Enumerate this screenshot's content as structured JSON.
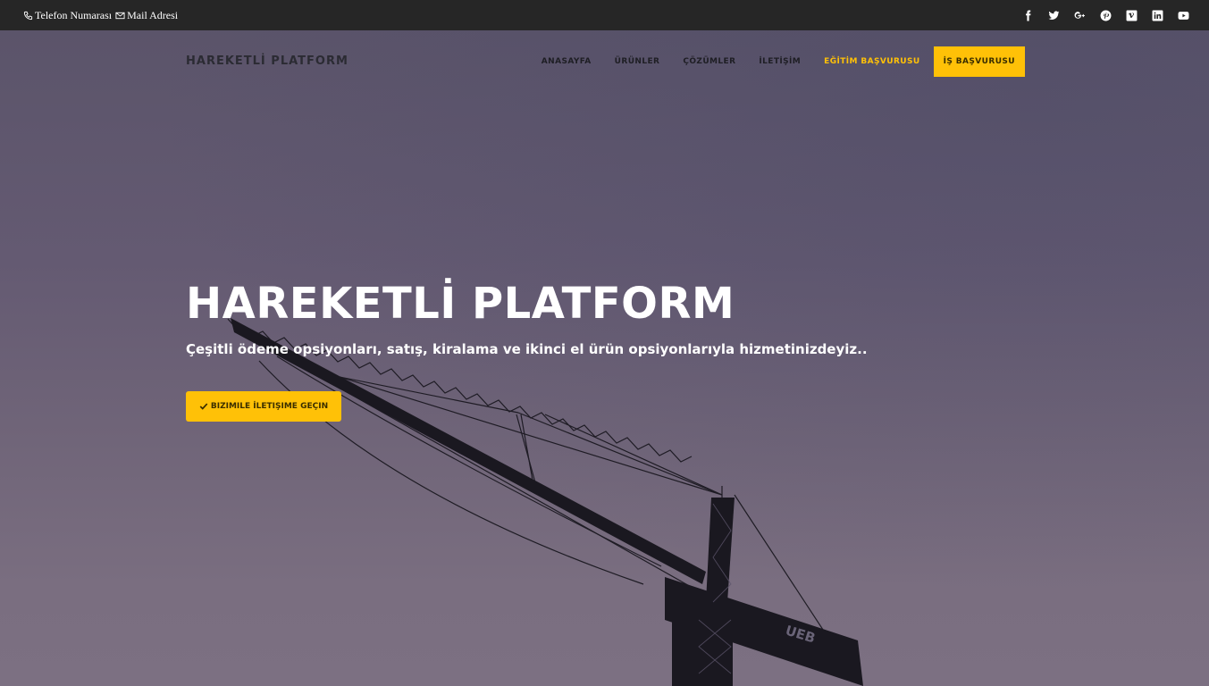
{
  "topbar": {
    "phone_label": "Telefon  Numarası",
    "mail_label": "Mail  Adresi",
    "socials": [
      "facebook-icon",
      "twitter-icon",
      "google-plus-icon",
      "pinterest-icon",
      "vimeo-icon",
      "linkedin-icon",
      "youtube-icon"
    ]
  },
  "nav": {
    "brand": "HAREKETLİ PLATFORM",
    "items": [
      {
        "label": "ANASAYFA"
      },
      {
        "label": "ÜRÜNLER"
      },
      {
        "label": "ÇÖZÜMLER"
      },
      {
        "label": "İLETİŞİM"
      },
      {
        "label": "EĞİTİM BAŞVURUSU"
      },
      {
        "label": "İŞ BAŞVURUSU"
      }
    ]
  },
  "hero": {
    "title": "HAREKETLİ PLATFORM",
    "subtitle": "Çeşitli ödeme opsiyonları, satış, kiralama ve ikinci el ürün opsiyonlarıyla hizmetinizdeyiz..",
    "cta_label": "BIZIMILE İLETIŞIME GEÇIN",
    "crane_sign": "UEB"
  },
  "colors": {
    "accent": "#ffc107",
    "topbar_bg": "#262626",
    "sky_top": "#5b546a",
    "sky_bottom": "#7c7082"
  }
}
